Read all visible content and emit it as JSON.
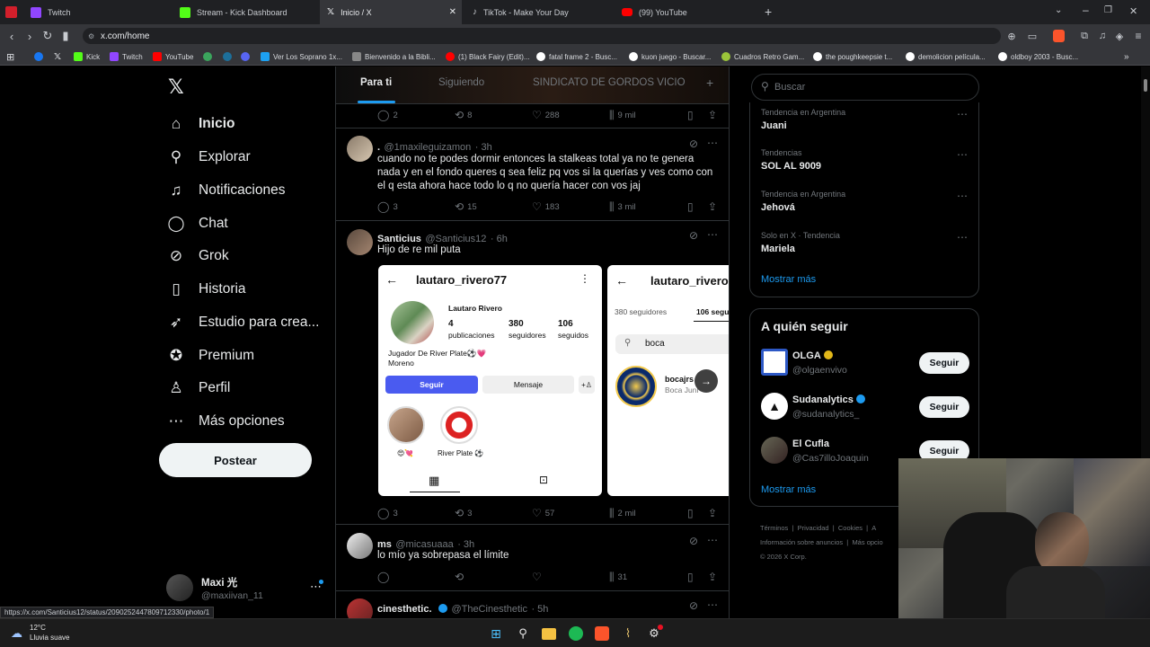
{
  "browser": {
    "tabs": [
      {
        "title": "Twitch",
        "color": "#9146ff"
      },
      {
        "title": "Stream - Kick Dashboard",
        "color": "#53fc18"
      },
      {
        "title": "Inicio / X",
        "color": "#ffffff"
      },
      {
        "title": "TikTok - Make Your Day",
        "color": "#fe2c55"
      },
      {
        "title": "(99) YouTube",
        "color": "#ff0000"
      }
    ],
    "url": "x.com/home",
    "bookmarks": [
      "Kick",
      "Twitch",
      "YouTube",
      "Ver Los Soprano 1x...",
      "Bienvenido a la Bibli...",
      "(1) Black Fairy (Edit)...",
      "fatal frame 2 - Busc...",
      "kuon juego - Buscar...",
      "Cuadros Retro Gam...",
      "the poughkeepsie t...",
      "demolicion película...",
      "oldboy 2003 - Busc..."
    ]
  },
  "sidebar": {
    "items": [
      {
        "label": "Inicio",
        "icon": "home-icon"
      },
      {
        "label": "Explorar",
        "icon": "search-icon"
      },
      {
        "label": "Notificaciones",
        "icon": "bell-icon"
      },
      {
        "label": "Chat",
        "icon": "chat-icon"
      },
      {
        "label": "Grok",
        "icon": "grok-icon"
      },
      {
        "label": "Historia",
        "icon": "bookmark-icon"
      },
      {
        "label": "Estudio para crea...",
        "icon": "rocket-icon"
      },
      {
        "label": "Premium",
        "icon": "verified-icon"
      },
      {
        "label": "Perfil",
        "icon": "person-icon"
      },
      {
        "label": "Más opciones",
        "icon": "more-icon"
      }
    ],
    "post_label": "Postear",
    "account": {
      "name": "Maxi 光",
      "handle": "@maxiivan_11"
    }
  },
  "feed": {
    "tabs": [
      "Para ti",
      "Siguiendo",
      "SINDICATO DE GORDOS VICIO"
    ],
    "top_actions": {
      "replies": "2",
      "reposts": "8",
      "likes": "288",
      "views": "9 mil"
    },
    "tweets": [
      {
        "name": ".",
        "handle": "@1maxileguizamon",
        "time": "· 3h",
        "text": "cuando no te podes dormir entonces la stalkeas total ya no te genera nada y en el fondo queres q sea feliz pq vos si la querías y ves como con el q esta ahora hace todo lo q no quería hacer con vos jaj",
        "replies": "3",
        "reposts": "15",
        "likes": "183",
        "views": "3 mil"
      },
      {
        "name": "Santicius",
        "handle": "@Santicius12",
        "time": "· 6h",
        "text": "Hijo de re mil puta",
        "replies": "3",
        "reposts": "3",
        "likes": "57",
        "views": "2 mil"
      },
      {
        "name": "ms",
        "handle": "@micasuaaa",
        "time": "· 3h",
        "text": "lo mío ya sobrepasa el límite",
        "replies": "",
        "reposts": "",
        "likes": "",
        "views": "31"
      },
      {
        "name": "cinesthetic.",
        "handle": "@TheCinesthetic",
        "time": "· 5h"
      }
    ],
    "screenshot1": {
      "username": "lautaro_rivero77",
      "fullname": "Lautaro Rivero",
      "posts": "4",
      "posts_label": "publicaciones",
      "followers": "380",
      "followers_label": "seguidores",
      "following": "106",
      "following_label": "seguidos",
      "bio": "Jugador De River Plate⚽💗",
      "bio2": "Moreno",
      "follow_btn": "Seguir",
      "message_btn": "Mensaje",
      "highlight1": "😍💘",
      "highlight2": "River Plate ⚽"
    },
    "screenshot2": {
      "username": "lautaro_rivero77",
      "tab1": "380 seguidores",
      "tab2": "106 segu",
      "search": "boca",
      "result_name": "bocajrs",
      "result_sub": "Boca Juni"
    }
  },
  "right": {
    "search_placeholder": "Buscar",
    "trends": [
      {
        "meta": "Tendencia en Argentina",
        "title": "Juani"
      },
      {
        "meta": "Tendencias",
        "title": "SOL AL 9009"
      },
      {
        "meta": "Tendencia en Argentina",
        "title": "Jehová"
      },
      {
        "meta": "Solo en X · Tendencia",
        "title": "Mariela"
      }
    ],
    "show_more": "Mostrar más",
    "who_to_follow_title": "A quién seguir",
    "follows": [
      {
        "name": "OLGA",
        "handle": "@olgaenvivo",
        "button": "Seguir",
        "badge": "#e2b719"
      },
      {
        "name": "Sudanalytics",
        "handle": "@sudanalytics_",
        "button": "Seguir",
        "badge": "#1d9bf0"
      },
      {
        "name": "El Cufla",
        "handle": "@Cas7illoJoaquin",
        "button": "Seguir"
      }
    ],
    "show_more2": "Mostrar más",
    "footer1": [
      "Términos",
      "Privacidad",
      "Cookies",
      "A"
    ],
    "footer2": [
      "Información sobre anuncios",
      "Más opcio"
    ],
    "copyright": "© 2026 X Corp."
  },
  "status_url": "https://x.com/Santicius12/status/2090252447809712330/photo/1",
  "taskbar": {
    "temp": "12°C",
    "weather": "Lluvia suave"
  }
}
